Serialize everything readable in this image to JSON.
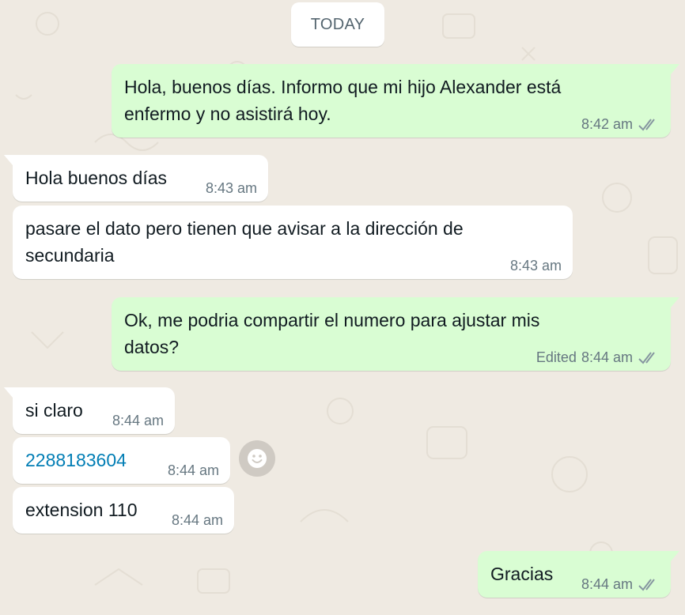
{
  "date_divider": "TODAY",
  "colors": {
    "outgoing_bubble": "#d9fdd3",
    "incoming_bubble": "#ffffff",
    "wallpaper": "#efeae2",
    "meta_text": "#667781",
    "link": "#027eb5",
    "read_ticks": "#8696a0"
  },
  "messages": [
    {
      "direction": "outgoing",
      "lines": [
        "Hola, buenos días. Informo que mi hijo Alexander está",
        "enfermo y no asistirá hoy."
      ],
      "time": "8:42 am",
      "status": "read-ticks-icon"
    },
    {
      "direction": "incoming",
      "lines": [
        "Hola buenos días"
      ],
      "time": "8:43 am"
    },
    {
      "direction": "incoming",
      "lines": [
        "pasare el dato pero tienen que avisar a la dirección de",
        "secundaria"
      ],
      "time": "8:43 am"
    },
    {
      "direction": "outgoing",
      "lines": [
        "Ok, me podria compartir el numero para ajustar mis",
        "datos?"
      ],
      "edited_label": "Edited",
      "time": "8:44 am",
      "status": "read-ticks-icon"
    },
    {
      "direction": "incoming",
      "lines": [
        "si claro"
      ],
      "time": "8:44 am"
    },
    {
      "direction": "incoming",
      "lines": [
        "2288183604"
      ],
      "time": "8:44 am",
      "is_link": true
    },
    {
      "direction": "incoming",
      "lines": [
        "extension 110"
      ],
      "time": "8:44 am"
    },
    {
      "direction": "outgoing",
      "lines": [
        "Gracias"
      ],
      "time": "8:44 am",
      "status": "read-ticks-icon"
    }
  ],
  "reaction_button_icon": "smiley-icon"
}
